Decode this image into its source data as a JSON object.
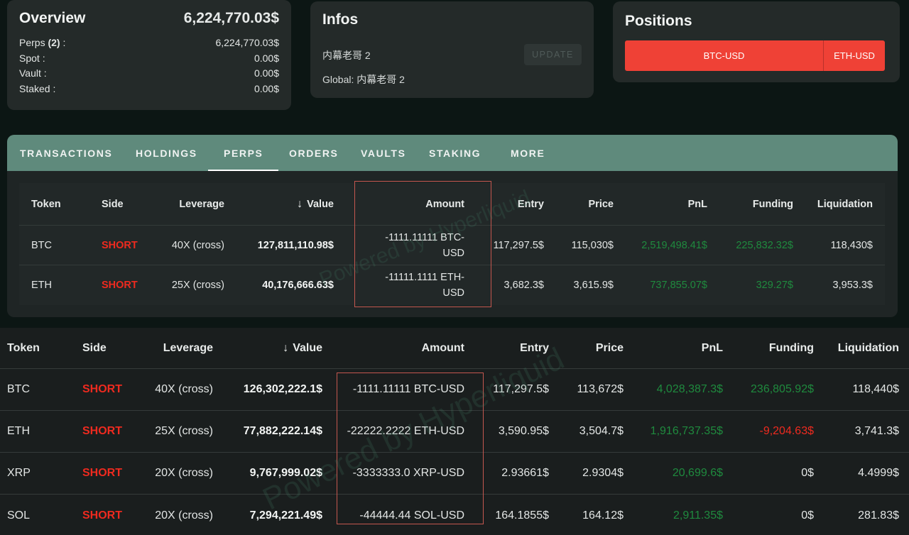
{
  "overview": {
    "title": "Overview",
    "total": "6,224,770.03$",
    "rows": [
      {
        "label_pre": "Perps ",
        "label_bold": "(2)",
        "label_post": " :",
        "value": "6,224,770.03$"
      },
      {
        "label_pre": "Spot :",
        "label_bold": "",
        "label_post": "",
        "value": "0.00$"
      },
      {
        "label_pre": "Vault :",
        "label_bold": "",
        "label_post": "",
        "value": "0.00$"
      },
      {
        "label_pre": "Staked :",
        "label_bold": "",
        "label_post": "",
        "value": "0.00$"
      }
    ]
  },
  "infos": {
    "title": "Infos",
    "name": "内幕老哥 2",
    "global": "Global: 内幕老哥 2",
    "update_label": "UPDATE"
  },
  "positions": {
    "title": "Positions",
    "buttons": [
      "BTC-USD",
      "ETH-USD"
    ]
  },
  "tabs": [
    "TRANSACTIONS",
    "HOLDINGS",
    "PERPS",
    "ORDERS",
    "VAULTS",
    "STAKING",
    "MORE"
  ],
  "active_tab": "PERPS",
  "watermark": "Powered by Hyperliquid",
  "columns": [
    "Token",
    "Side",
    "Leverage",
    "Value",
    "Amount",
    "Entry",
    "Price",
    "PnL",
    "Funding",
    "Liquidation"
  ],
  "sort_icon": "arrow-down-icon",
  "table1": [
    {
      "token": "BTC",
      "side": "SHORT",
      "leverage": "40X (cross)",
      "value": "127,811,110.98$",
      "amount_l1": "-1111.11111 BTC-",
      "amount_l2": "USD",
      "entry": "117,297.5$",
      "price": "115,030$",
      "pnl": "2,519,498.41$",
      "funding": "225,832.32$",
      "liquidation": "118,430$"
    },
    {
      "token": "ETH",
      "side": "SHORT",
      "leverage": "25X (cross)",
      "value": "40,176,666.63$",
      "amount_l1": "-11111.1111 ETH-",
      "amount_l2": "USD",
      "entry": "3,682.3$",
      "price": "3,615.9$",
      "pnl": "737,855.07$",
      "funding": "329.27$",
      "liquidation": "3,953.3$"
    }
  ],
  "table2": [
    {
      "token": "BTC",
      "side": "SHORT",
      "leverage": "40X (cross)",
      "value": "126,302,222.1$",
      "amount": "-1111.11111 BTC-USD",
      "entry": "117,297.5$",
      "price": "113,672$",
      "pnl": "4,028,387.3$",
      "funding": "236,805.92$",
      "liquidation": "118,440$"
    },
    {
      "token": "ETH",
      "side": "SHORT",
      "leverage": "25X (cross)",
      "value": "77,882,222.14$",
      "amount": "-22222.2222 ETH-USD",
      "entry": "3,590.95$",
      "price": "3,504.7$",
      "pnl": "1,916,737.35$",
      "funding": "-9,204.63$",
      "liquidation": "3,741.3$"
    },
    {
      "token": "XRP",
      "side": "SHORT",
      "leverage": "20X (cross)",
      "value": "9,767,999.02$",
      "amount": "-3333333.0 XRP-USD",
      "entry": "2.93661$",
      "price": "2.9304$",
      "pnl": "20,699.6$",
      "funding": "0$",
      "liquidation": "4.4999$"
    },
    {
      "token": "SOL",
      "side": "SHORT",
      "leverage": "20X (cross)",
      "value": "7,294,221.49$",
      "amount": "-44444.44 SOL-USD",
      "entry": "164.1855$",
      "price": "164.12$",
      "pnl": "2,911.35$",
      "funding": "0$",
      "liquidation": "281.83$"
    }
  ],
  "colors": {
    "accent_tab_bar": "#5f8a7c",
    "short": "#ee2a1f",
    "positive": "#1f8a3e",
    "negative": "#ee2a1f",
    "position_button": "#ef4136"
  }
}
